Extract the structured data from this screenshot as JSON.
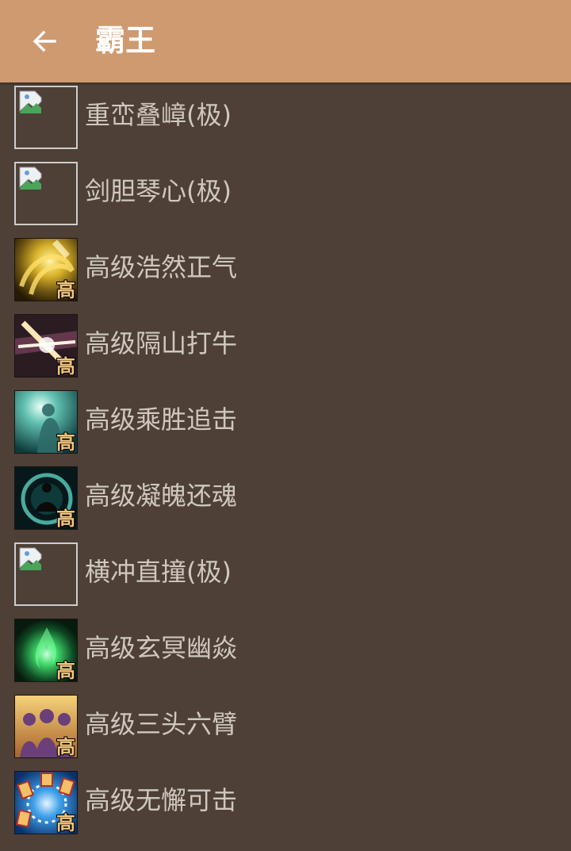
{
  "header": {
    "title": "霸王",
    "background": "#cf9a6f"
  },
  "skills": [
    {
      "name": "重峦叠嶂(极)",
      "icon": "broken-image-icon"
    },
    {
      "name": "剑胆琴心(极)",
      "icon": "broken-image-icon"
    },
    {
      "name": "高级浩然正气",
      "icon": "golden-swirl-icon",
      "badge": "高"
    },
    {
      "name": "高级隔山打牛",
      "icon": "light-burst-icon",
      "badge": "高"
    },
    {
      "name": "高级乘胜追击",
      "icon": "spirit-figure-icon",
      "badge": "高"
    },
    {
      "name": "高级凝魄还魂",
      "icon": "meditation-aura-icon",
      "badge": "高"
    },
    {
      "name": "横冲直撞(极)",
      "icon": "broken-image-icon"
    },
    {
      "name": "高级玄冥幽焱",
      "icon": "green-flame-icon",
      "badge": "高"
    },
    {
      "name": "高级三头六臂",
      "icon": "three-figures-icon",
      "badge": "高"
    },
    {
      "name": "高级无懈可击",
      "icon": "rune-circle-icon",
      "badge": "高"
    }
  ],
  "colors": {
    "list_background": "#4e4036",
    "label_text": "#cfc7c0",
    "badge_text": "#f1c47c"
  }
}
